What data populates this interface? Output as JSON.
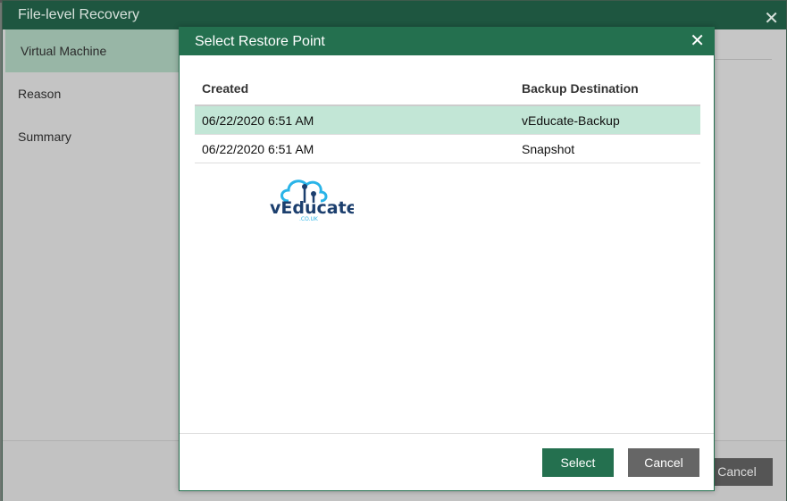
{
  "outer": {
    "title": "File-level Recovery",
    "sidebar": [
      "Virtual Machine",
      "Reason",
      "Summary"
    ],
    "cancel_label": "Cancel"
  },
  "modal": {
    "title": "Select Restore Point",
    "columns": [
      "Created",
      "Backup Destination"
    ],
    "rows": [
      {
        "created": "06/22/2020 6:51 AM",
        "destination": "vEducate-Backup",
        "selected": true
      },
      {
        "created": "06/22/2020 6:51 AM",
        "destination": "Snapshot",
        "selected": false
      }
    ],
    "select_label": "Select",
    "cancel_label": "Cancel"
  },
  "logo": {
    "text": "vEducate",
    "sub": ".CO.UK"
  }
}
